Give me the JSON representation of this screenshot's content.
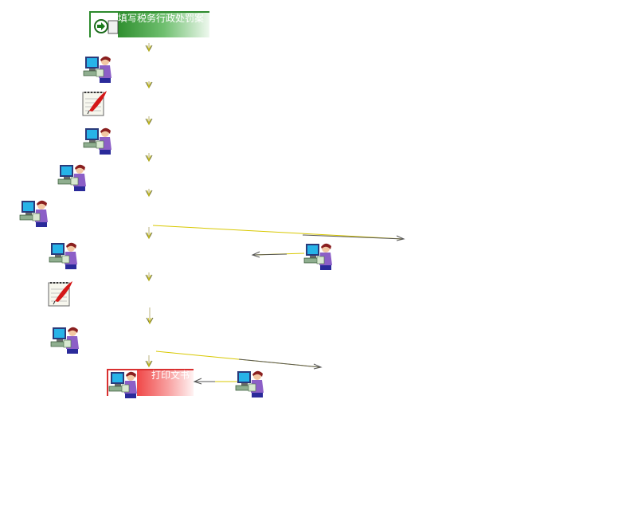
{
  "start_node": {
    "label": "填写税务行政处罚案"
  },
  "end_node": {
    "label": "打印文书"
  },
  "icons": {
    "start": "arrow-circle-icon",
    "worker": "person-at-computer-icon",
    "document": "notepad-quill-icon",
    "end": "printer-worker-icon"
  },
  "colors": {
    "start_accent": "#2f8f2f",
    "end_accent": "#f04848",
    "arrow_head": "#6b6b3a",
    "arrow_line": "#d8c800"
  }
}
